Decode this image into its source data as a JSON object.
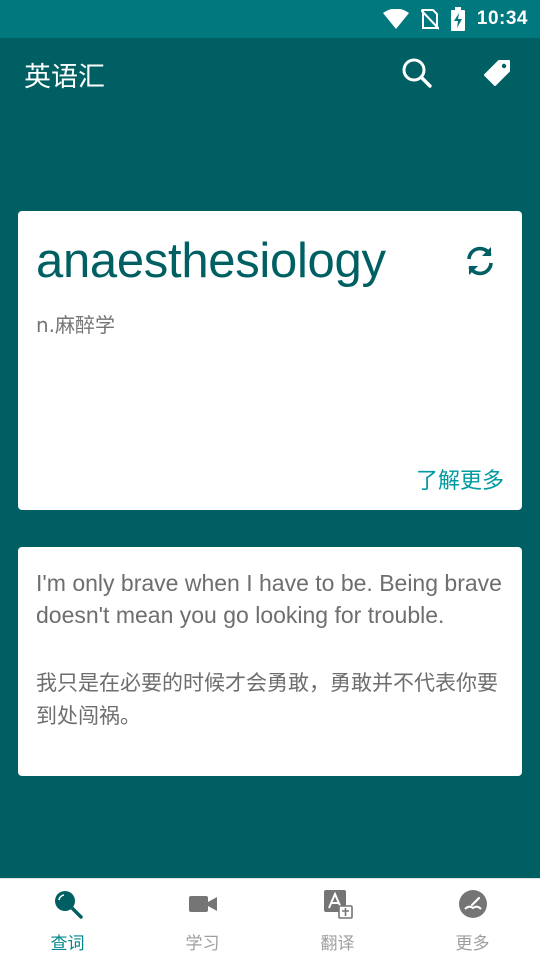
{
  "status_bar": {
    "time": "10:34"
  },
  "app_bar": {
    "title": "英语汇"
  },
  "word_card": {
    "word": "anaesthesiology",
    "definition": "n.麻醉学",
    "learn_more": "了解更多"
  },
  "quote_card": {
    "english": "I'm only brave when I have to be. Being brave doesn't mean you go looking for trouble.",
    "chinese": "我只是在必要的时候才会勇敢，勇敢并不代表你要到处闯祸。"
  },
  "bottom_nav": {
    "items": [
      {
        "label": "查词",
        "icon": "search-icon",
        "active": true
      },
      {
        "label": "学习",
        "icon": "video-camera-icon",
        "active": false
      },
      {
        "label": "翻译",
        "icon": "translate-icon",
        "active": false
      },
      {
        "label": "更多",
        "icon": "more-icon",
        "active": false
      }
    ]
  },
  "colors": {
    "primary": "#005f63",
    "status_bar": "#00787d",
    "accent": "#009aa0"
  }
}
